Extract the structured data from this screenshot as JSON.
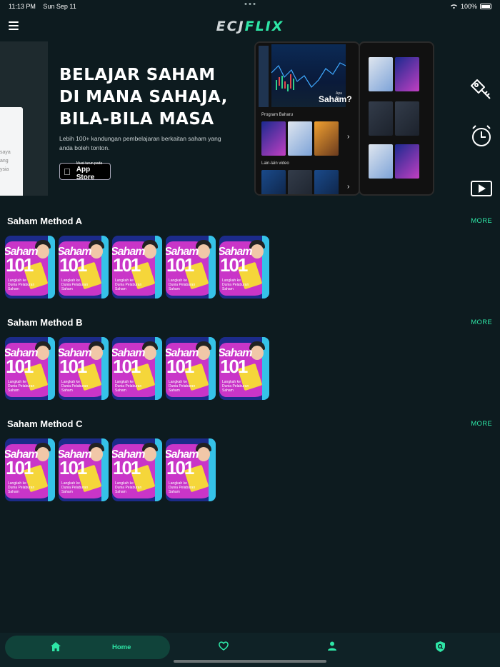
{
  "status_bar": {
    "time": "11:13 PM",
    "date": "Sun Sep 11",
    "battery": "100%"
  },
  "header": {
    "logo_part1": "ECJ",
    "logo_part2": "FLIX"
  },
  "hero": {
    "title_line1": "BELAJAR SAHAM",
    "title_line2": "DI MANA SAHAJA,",
    "title_line3": "BILA-BILA MASA",
    "description": "Lebih 100+ kandungan pembelajaran berkaitan saham yang anda boleh tonton.",
    "appstore_small": "Muat turun pada",
    "appstore_big": "App Store",
    "left_card_text": [
      "saya",
      "ang",
      "ysia"
    ],
    "phone": {
      "video_question_small": "Apa itu",
      "video_question": "Saham?",
      "program_label": "Program Baharu",
      "other_label": "Lain-lain video"
    }
  },
  "sections": [
    {
      "title": "Saham Method A",
      "more": "MORE",
      "count": 5
    },
    {
      "title": "Saham Method B",
      "more": "MORE",
      "count": 5
    },
    {
      "title": "Saham Method C",
      "more": "MORE",
      "count": 4
    }
  ],
  "card": {
    "t1": "Saham",
    "t2": "101",
    "caption": "Langkah ke Dunia Pelaburan Saham"
  },
  "bottom_nav": {
    "home_label": "Home"
  },
  "colors": {
    "accent": "#2ee6a6",
    "background": "#0d1b1f",
    "nav_active": "#10433a"
  }
}
